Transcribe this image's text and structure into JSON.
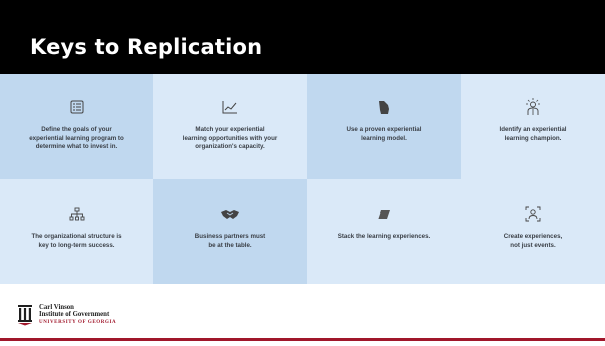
{
  "slide": {
    "title": "Keys to Replication"
  },
  "tiles": [
    {
      "icon": "checklist-icon",
      "text": "Define the goals of your\nexperiential learning program to\ndetermine what to invest in."
    },
    {
      "icon": "line-chart-icon",
      "text": "Match your experiential\nlearning opportunities with your\norganization's capacity."
    },
    {
      "icon": "georgia-map-icon",
      "text": "Use a proven experiential\nlearning model."
    },
    {
      "icon": "person-lightbulb-icon",
      "text": "Identify an experiential\nlearning champion."
    },
    {
      "icon": "org-chart-icon",
      "text": "The organizational structure is\nkey to long-term success."
    },
    {
      "icon": "handshake-icon",
      "text": "Business partners must\nbe at the table."
    },
    {
      "icon": "eraser-icon",
      "text": "Stack the learning experiences."
    },
    {
      "icon": "person-focus-icon",
      "text": "Create experiences,\nnot just events."
    }
  ],
  "footer": {
    "org_line1": "Carl Vinson",
    "org_line2": "Institute of Government",
    "org_line3": "UNIVERSITY OF GEORGIA",
    "logo_icon": "arch-logo-icon",
    "accent_color": "#a0162a"
  },
  "colors": {
    "header_bg": "#000000",
    "tile_light": "#dae9f8",
    "tile_dark": "#c0d8ef"
  }
}
